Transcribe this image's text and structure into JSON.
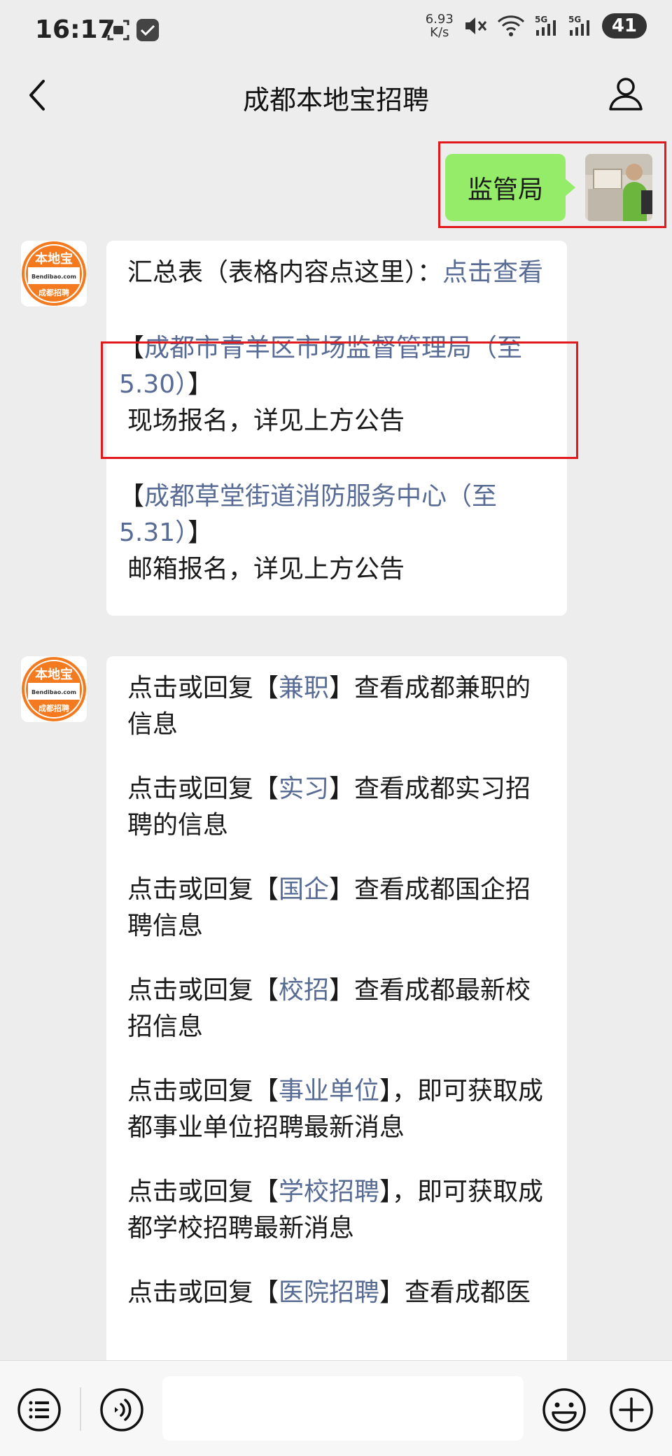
{
  "status_bar": {
    "time": "16:17",
    "net_speed_value": "6.93",
    "net_speed_unit": "K/s",
    "signal_1": "5G",
    "signal_2": "5G",
    "battery": "41"
  },
  "header": {
    "title": "成都本地宝招聘",
    "back_icon": "chevron-left-icon",
    "profile_icon": "user-icon"
  },
  "avatar_logo": {
    "brand": "本地宝",
    "domain": "Bendibao.com",
    "subtitle": "成都招聘",
    "brand_color": "#f47a1f"
  },
  "messages": {
    "sent": {
      "text": "监管局"
    },
    "msg1": {
      "summary_prefix": "汇总表（表格内容点这里）：",
      "summary_link": "点击查看",
      "item1_open": "【",
      "item1_link": "成都市青羊区市场监督管理局（至5.30）",
      "item1_close": "】",
      "item1_note": "现场报名，详见上方公告",
      "item2_open": "【",
      "item2_link": "成都草堂街道消防服务中心（至5.31）",
      "item2_close": "】",
      "item2_note": "邮箱报名，详见上方公告"
    },
    "msg2": {
      "lines": [
        {
          "pre": "点击或回复【",
          "link": "兼职",
          "post": "】查看成都兼职的信息"
        },
        {
          "pre": "点击或回复【",
          "link": "实习",
          "post": "】查看成都实习招聘的信息"
        },
        {
          "pre": "点击或回复【",
          "link": "国企",
          "post": "】查看成都国企招聘信息"
        },
        {
          "pre": "点击或回复【",
          "link": "校招",
          "post": "】查看成都最新校招信息"
        },
        {
          "pre": "点击或回复【",
          "link": "事业单位",
          "post": "】，即可获取成都事业单位招聘最新消息"
        },
        {
          "pre": "点击或回复【",
          "link": "学校招聘",
          "post": "】，即可获取成都学校招聘最新消息"
        },
        {
          "pre": "点击或回复【",
          "link": "医院招聘",
          "post": "】查看成都医"
        }
      ]
    }
  },
  "colors": {
    "link": "#576b95",
    "sent_bubble": "#95ec69",
    "highlight_box": "#e0191d"
  },
  "input_bar": {
    "menu_icon": "list-menu-icon",
    "voice_icon": "voice-icon",
    "emoji_icon": "emoji-icon",
    "plus_icon": "plus-circle-icon"
  }
}
